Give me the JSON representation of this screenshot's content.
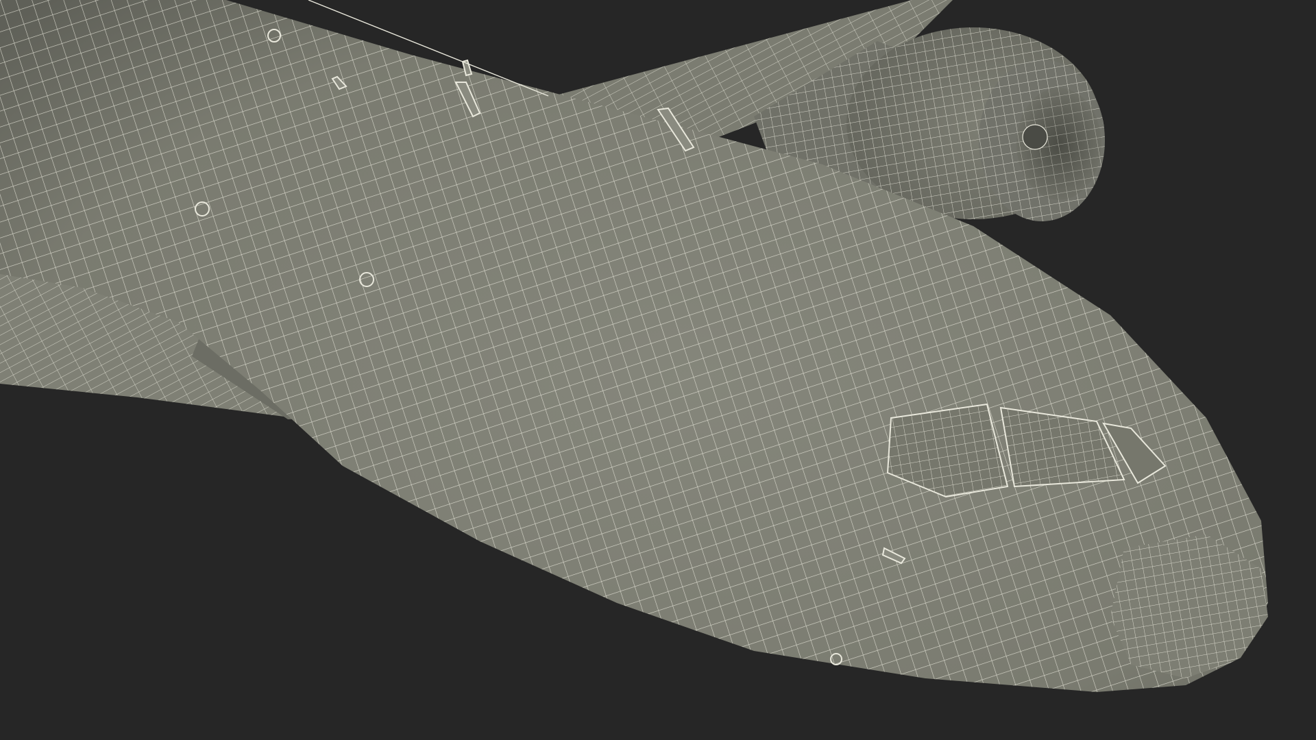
{
  "render": {
    "background_color": "#262626",
    "surface_color": "#7c7d72",
    "surface_shadow_color": "#5f6058",
    "surface_light_color": "#8a8b80",
    "wire_color": "#e9e8dc",
    "subject": "aircraft-wireframe-model"
  }
}
